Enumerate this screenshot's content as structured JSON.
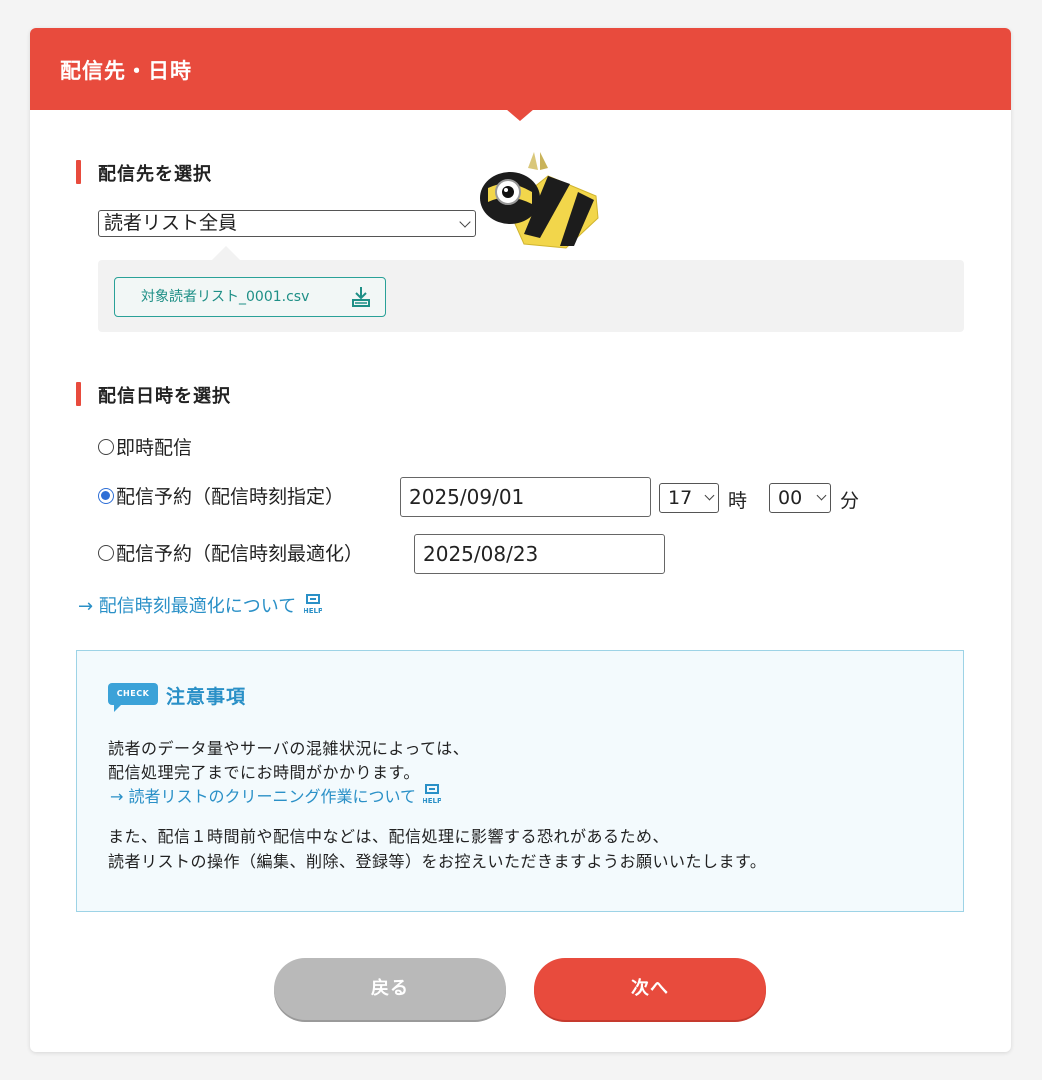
{
  "header": {
    "title": "配信先・日時"
  },
  "destination": {
    "section_title": "配信先を選択",
    "select_value": "読者リスト全員",
    "csv_button_label": "対象読者リスト_0001.csv"
  },
  "datetime": {
    "section_title": "配信日時を選択",
    "options": [
      {
        "label": "即時配信",
        "selected": false
      },
      {
        "label": "配信予約（配信時刻指定）",
        "selected": true,
        "date_value": "2025/09/01",
        "hour_value": "17",
        "hour_unit": "時",
        "minute_value": "00",
        "minute_unit": "分"
      },
      {
        "label": "配信予約（配信時刻最適化）",
        "selected": false,
        "date_value": "2025/08/23"
      }
    ],
    "optimize_link": "→ 配信時刻最適化について"
  },
  "notice": {
    "badge": "CHECK",
    "title": "注意事項",
    "line1": "読者のデータ量やサーバの混雑状況によっては、",
    "line2": "配信処理完了までにお時間がかかります。",
    "link": "→ 読者リストのクリーニング作業について",
    "line3": "また、配信１時間前や配信中などは、配信処理に影響する恐れがあるため、",
    "line4": "読者リストの操作（編集、削除、登録等）をお控えいただきますようお願いいたします。"
  },
  "buttons": {
    "back": "戻る",
    "next": "次へ"
  },
  "colors": {
    "accent": "#e84b3d",
    "link": "#2a90c7",
    "teal": "#2aa198",
    "notice_bg": "#f3fafd"
  },
  "icons": {
    "mascot": "bee-mascot-icon",
    "download": "download-icon",
    "help": "help-icon"
  }
}
